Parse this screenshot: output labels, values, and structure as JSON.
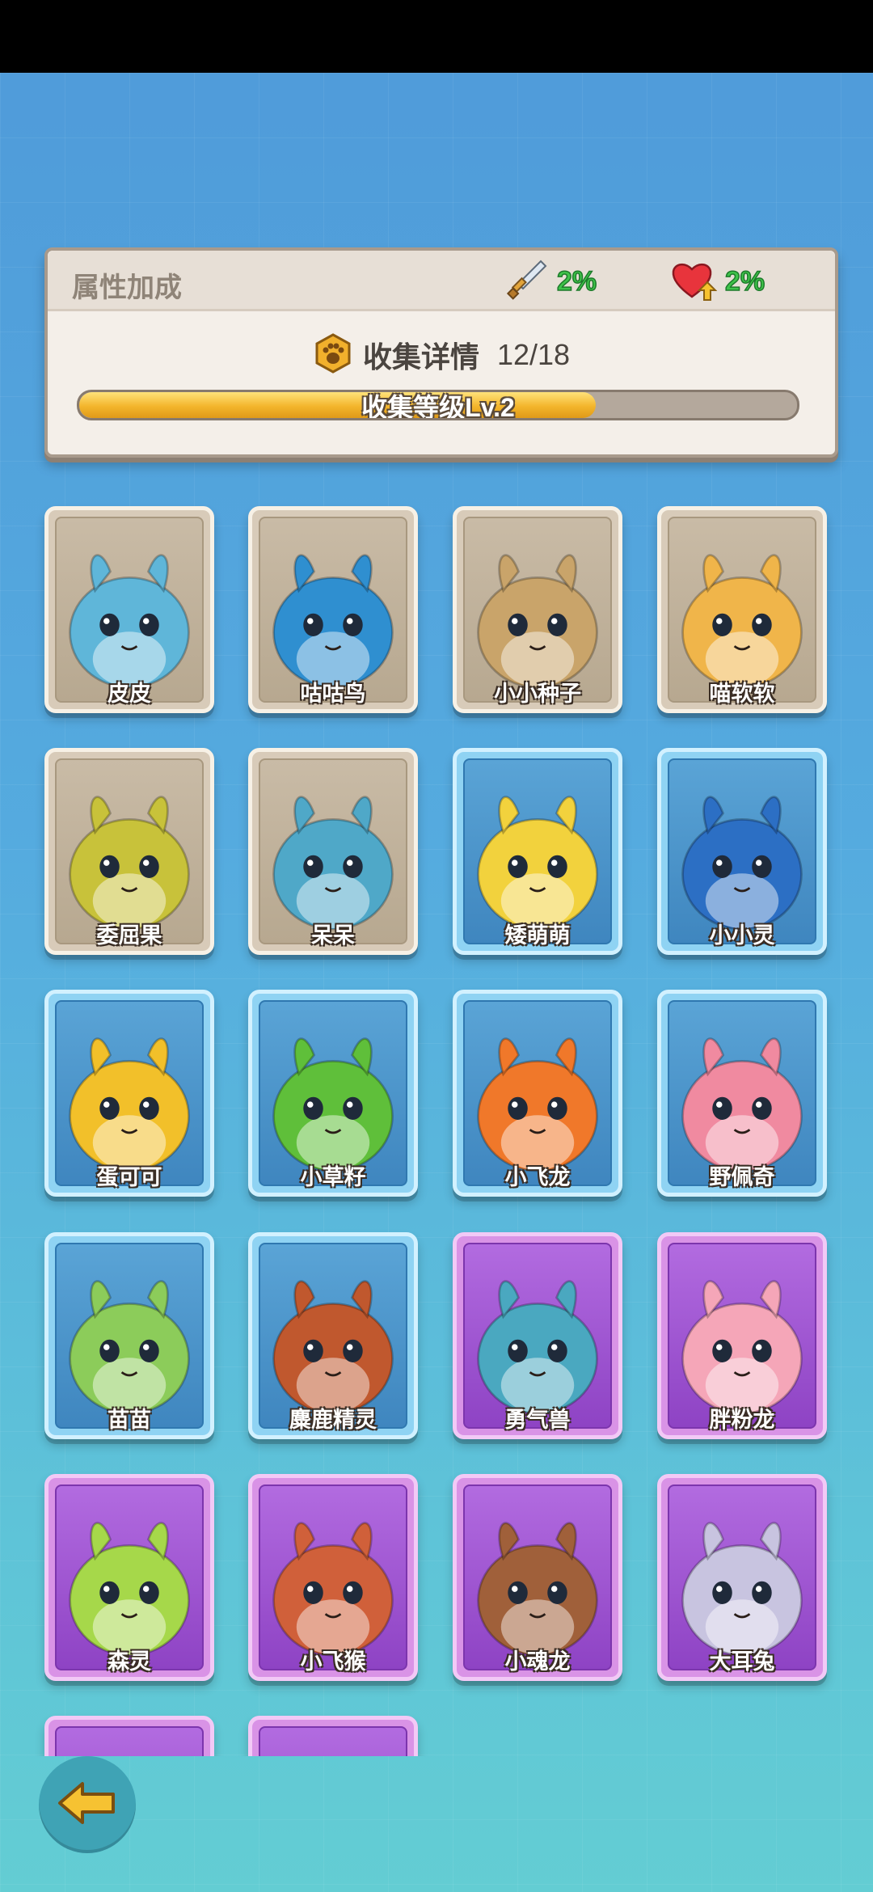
{
  "panel": {
    "title": "属性加成",
    "attack_bonus": "2%",
    "hp_bonus": "2%",
    "collect_label": "收集详情",
    "collect_count": "12/18",
    "level_text": "收集等级Lv.2",
    "progress_fraction": 0.72
  },
  "colors": {
    "common_frame": "#f7f1e6",
    "rare_frame": "#d2f1ff",
    "epic_frame": "#f2c9f6",
    "bonus_green": "#3fc34a",
    "progress_gold": "#f3b52c"
  },
  "cards": [
    {
      "name": "皮皮",
      "rarity": "common",
      "color": "#5fb6d9"
    },
    {
      "name": "咕咕鸟",
      "rarity": "common",
      "color": "#2f8fd0"
    },
    {
      "name": "小小种子",
      "rarity": "common",
      "color": "#c9a46a"
    },
    {
      "name": "喵软软",
      "rarity": "common",
      "color": "#f0b54a"
    },
    {
      "name": "委屈果",
      "rarity": "common",
      "color": "#c8c23a"
    },
    {
      "name": "呆呆",
      "rarity": "common",
      "color": "#4fa8c8"
    },
    {
      "name": "矮萌萌",
      "rarity": "rare",
      "color": "#f2d23d"
    },
    {
      "name": "小小灵",
      "rarity": "rare",
      "color": "#2c6fc4"
    },
    {
      "name": "蛋可可",
      "rarity": "rare",
      "color": "#f2c02a"
    },
    {
      "name": "小草籽",
      "rarity": "rare",
      "color": "#5fbf3a"
    },
    {
      "name": "小飞龙",
      "rarity": "rare",
      "color": "#f0782a"
    },
    {
      "name": "野佩奇",
      "rarity": "rare",
      "color": "#f08aa0"
    },
    {
      "name": "苗苗",
      "rarity": "rare",
      "color": "#8ccc5a"
    },
    {
      "name": "麋鹿精灵",
      "rarity": "rare",
      "color": "#c0582e"
    },
    {
      "name": "勇气兽",
      "rarity": "epic",
      "color": "#4aa8c0"
    },
    {
      "name": "胖粉龙",
      "rarity": "epic",
      "color": "#f5a6b8"
    },
    {
      "name": "森灵",
      "rarity": "epic",
      "color": "#a6d84a"
    },
    {
      "name": "小飞猴",
      "rarity": "epic",
      "color": "#d0603a"
    },
    {
      "name": "小魂龙",
      "rarity": "epic",
      "color": "#a0603a"
    },
    {
      "name": "大耳兔",
      "rarity": "epic",
      "color": "#c8c4e0"
    },
    {
      "name": "",
      "rarity": "epic",
      "color": "#e07aa0"
    },
    {
      "name": "",
      "rarity": "epic",
      "color": "#e0a03a"
    }
  ],
  "icons": {
    "attack": "sword-icon",
    "hp": "heart-icon",
    "collect": "paw-badge-icon",
    "back": "back-arrow-icon"
  }
}
